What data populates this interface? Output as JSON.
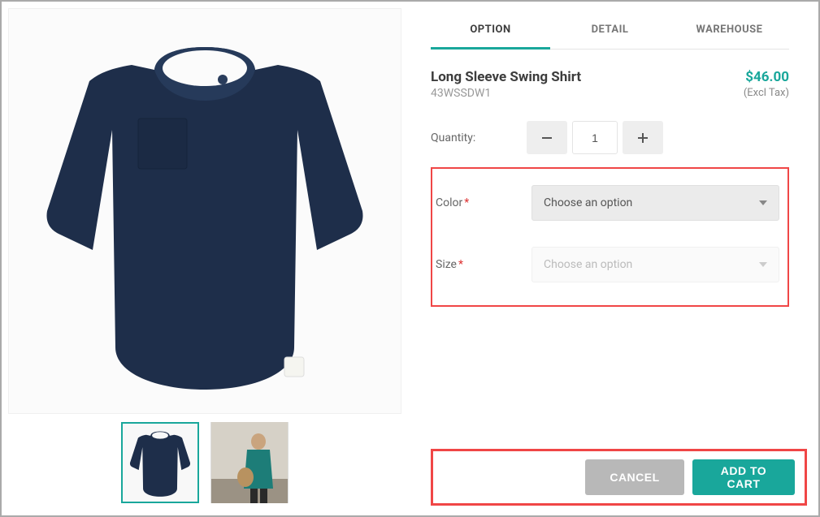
{
  "tabs": {
    "option": "OPTION",
    "detail": "DETAIL",
    "warehouse": "WAREHOUSE"
  },
  "product": {
    "title": "Long Sleeve Swing Shirt",
    "sku": "43WSSDW1",
    "price": "$46.00",
    "tax_note": "(Excl Tax)"
  },
  "quantity": {
    "label": "Quantity:",
    "value": "1"
  },
  "options": {
    "color": {
      "label": "Color",
      "placeholder": "Choose an option"
    },
    "size": {
      "label": "Size",
      "placeholder": "Choose an option"
    }
  },
  "buttons": {
    "cancel": "CANCEL",
    "add_to_cart": "ADD TO CART"
  }
}
